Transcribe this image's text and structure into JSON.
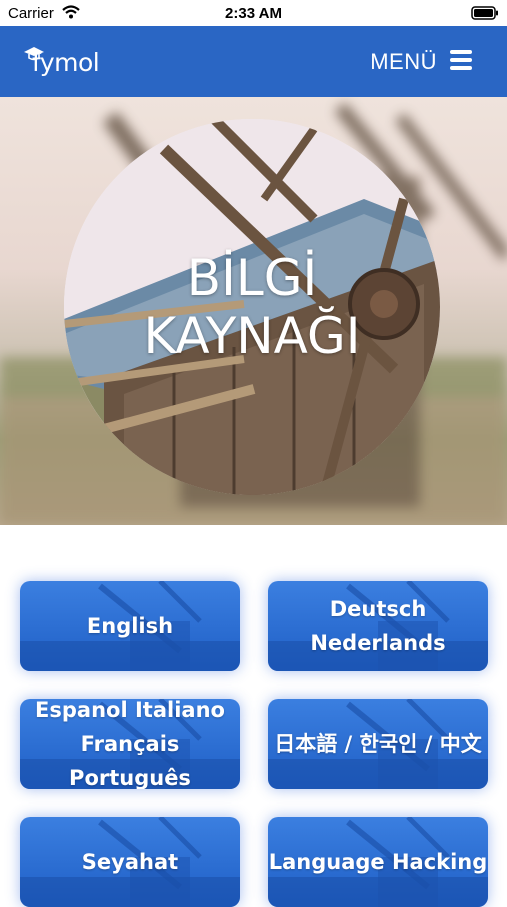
{
  "status_bar": {
    "carrier": "Carrier",
    "time": "2:33 AM"
  },
  "header": {
    "logo_text": "fymol",
    "menu_label": "MENÜ",
    "background": "#2a66c4"
  },
  "hero": {
    "title_line1": "BİLGİ",
    "title_line2": "KAYNAĞI"
  },
  "categories": [
    {
      "label": "English"
    },
    {
      "label": "Deutsch Nederlands"
    },
    {
      "label": "Espanol Italiano\nFrançais Português"
    },
    {
      "label": "日本語 / 한국인 / 中文"
    },
    {
      "label": "Seyahat"
    },
    {
      "label": "Language Hacking"
    }
  ],
  "colors": {
    "accent": "#2a66c4",
    "button_top": "#3b7fe0",
    "button_bottom": "#1f5fc6"
  }
}
